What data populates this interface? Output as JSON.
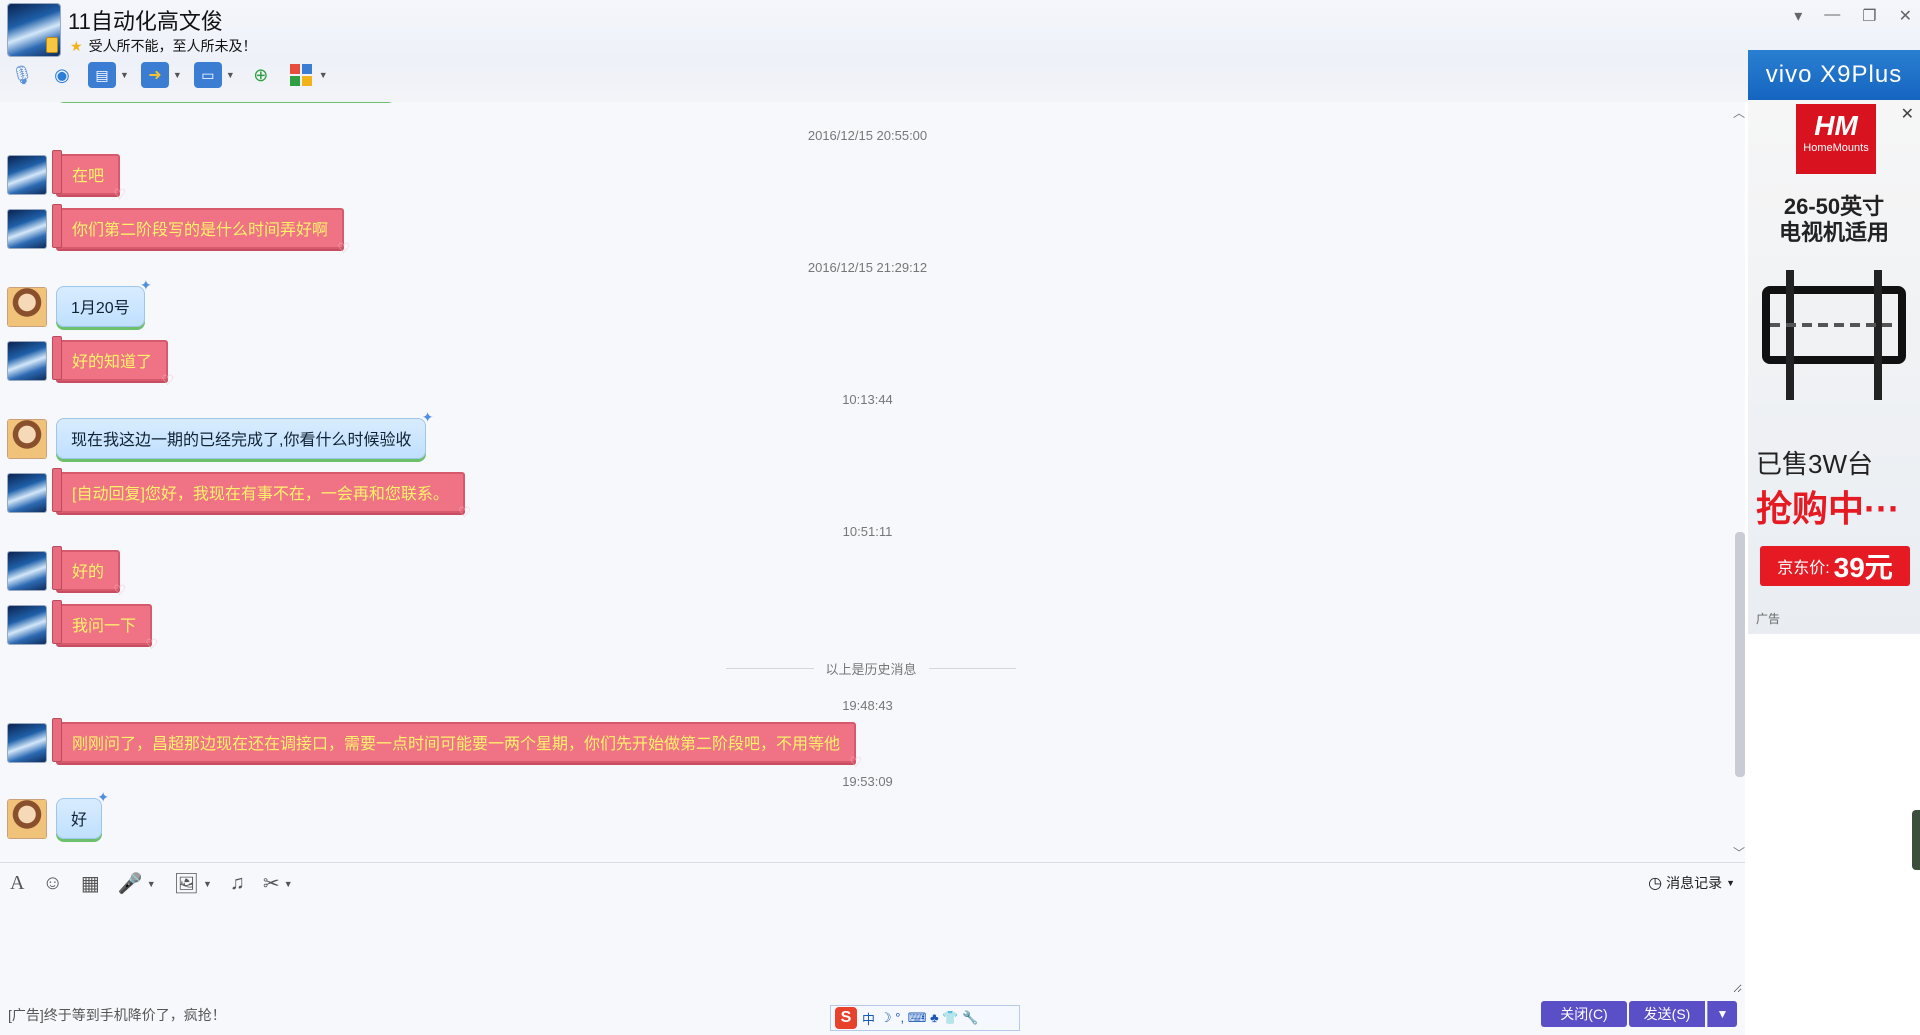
{
  "window": {
    "contact_name": "11自动化高文俊",
    "signature": "受人所不能，至人所未及！",
    "controls": [
      "▾",
      "—",
      "❐",
      "✕"
    ]
  },
  "toolbar": {
    "icons": [
      "microphone-icon",
      "video-call-icon",
      "remote-desktop-icon",
      "file-transfer-icon",
      "screen-share-icon",
      "create-group-icon",
      "apps-icon"
    ]
  },
  "chat": {
    "messages": [
      {
        "type": "timestamp",
        "text": "2016/12/15 20:55:00"
      },
      {
        "type": "msg",
        "side": "me",
        "text": "在吧"
      },
      {
        "type": "msg",
        "side": "me",
        "text": "你们第二阶段写的是什么时间弄好啊"
      },
      {
        "type": "timestamp",
        "text": "2016/12/15 21:29:12"
      },
      {
        "type": "msg",
        "side": "other",
        "text": "1月20号"
      },
      {
        "type": "msg",
        "side": "me",
        "text": "好的知道了"
      },
      {
        "type": "timestamp",
        "text": "10:13:44"
      },
      {
        "type": "msg",
        "side": "other",
        "text": "现在我这边一期的已经完成了,你看什么时候验收"
      },
      {
        "type": "msg",
        "side": "me",
        "text": "[自动回复]您好，我现在有事不在，一会再和您联系。"
      },
      {
        "type": "timestamp",
        "text": "10:51:11"
      },
      {
        "type": "msg",
        "side": "me",
        "text": "好的"
      },
      {
        "type": "msg",
        "side": "me",
        "text": "我问一下"
      },
      {
        "type": "divider",
        "text": "以上是历史消息"
      },
      {
        "type": "timestamp",
        "text": "19:48:43"
      },
      {
        "type": "msg",
        "side": "me",
        "text": "刚刚问了，昌超那边现在还在调接口，需要一点时间可能要一两个星期，你们先开始做第二阶段吧，不用等他"
      },
      {
        "type": "timestamp",
        "text": "19:53:09"
      },
      {
        "type": "msg",
        "side": "other",
        "text": "好"
      }
    ]
  },
  "input": {
    "history_label": "消息记录",
    "ad_text": "[广告]终于等到手机降价了，疯抢！",
    "close_label": "关闭(C)",
    "send_label": "发送(S)"
  },
  "ime": {
    "logo": "S",
    "mode": "中",
    "symbols": "☽ °, ⌨ ♣ 👕 🔧"
  },
  "ad_panel": {
    "top_banner": "vivo X9Plus",
    "brand": "HM",
    "brand_sub": "HomeMounts",
    "size_line1": "26-50英寸",
    "size_line2": "电视机适用",
    "sold": "已售3W台",
    "buy": "抢购中···",
    "price_label": "京东价:",
    "price": "39元",
    "ad_label": "广告"
  }
}
